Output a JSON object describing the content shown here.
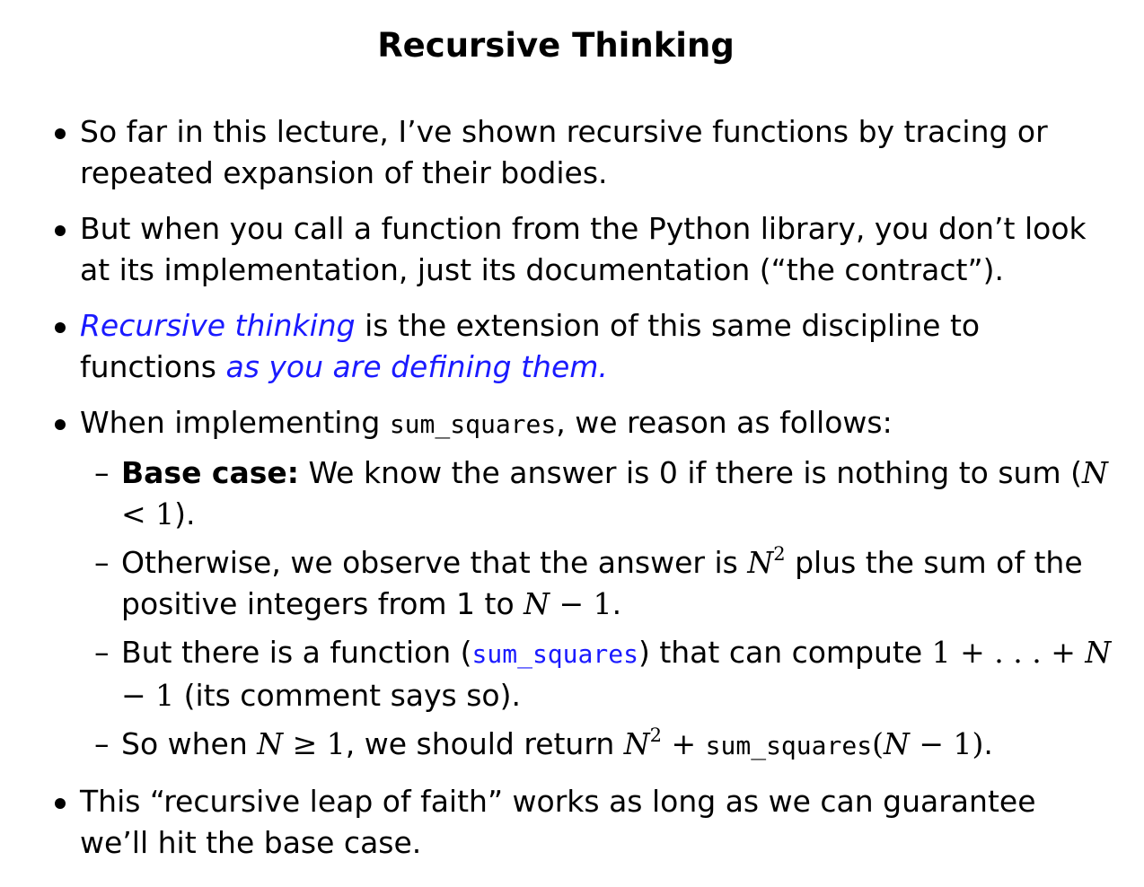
{
  "slide": {
    "title": "Recursive Thinking",
    "bullets": [
      {
        "text": "So far in this lecture, I’ve shown recursive functions by tracing or repeated expansion of their bodies."
      },
      {
        "text": "But when you call a function from the Python library, you don’t look at its implementation, just its documentation (“the contract”)."
      },
      {
        "highlight_start": "Recursive thinking",
        "text_middle": " is the extension of this same discipline to functions ",
        "highlight_end": "as you are defining them."
      },
      {
        "text_before": "When implementing ",
        "code": "sum_squares",
        "text_after": ", we reason as follows:",
        "sub": [
          {
            "bold_label": "Base case:",
            "text_before": " We know the answer is 0 if there is nothing to sum (",
            "math_var": "N",
            "math_rest": " < 1",
            "text_after": ")."
          },
          {
            "text_before": "Otherwise, we observe that the answer is ",
            "math_var": "N",
            "sup": "2",
            "text_middle": " plus the sum of the positive integers from 1 to ",
            "math_var2": "N",
            "math_rest2": " − 1",
            "text_after": "."
          },
          {
            "text_before": "But there is a function (",
            "code": "sum_squares",
            "text_middle": ") that can compute ",
            "math_expr": "1 + . . . + ",
            "math_var": "N",
            "math_rest": " − 1",
            "text_after": " (its comment says so)."
          },
          {
            "text_before": "So when ",
            "math_var": "N",
            "math_rest": " ≥ 1",
            "text_middle": ", we should return ",
            "math_var2": "N",
            "sup": "2",
            "math_plus": " + ",
            "code": "sum_squares",
            "math_open": "(",
            "math_var3": "N",
            "math_rest3": " − 1)",
            "text_after": "."
          }
        ]
      },
      {
        "text": "This “recursive leap of faith” works as long as we can guarantee we’ll hit the base case."
      }
    ]
  }
}
